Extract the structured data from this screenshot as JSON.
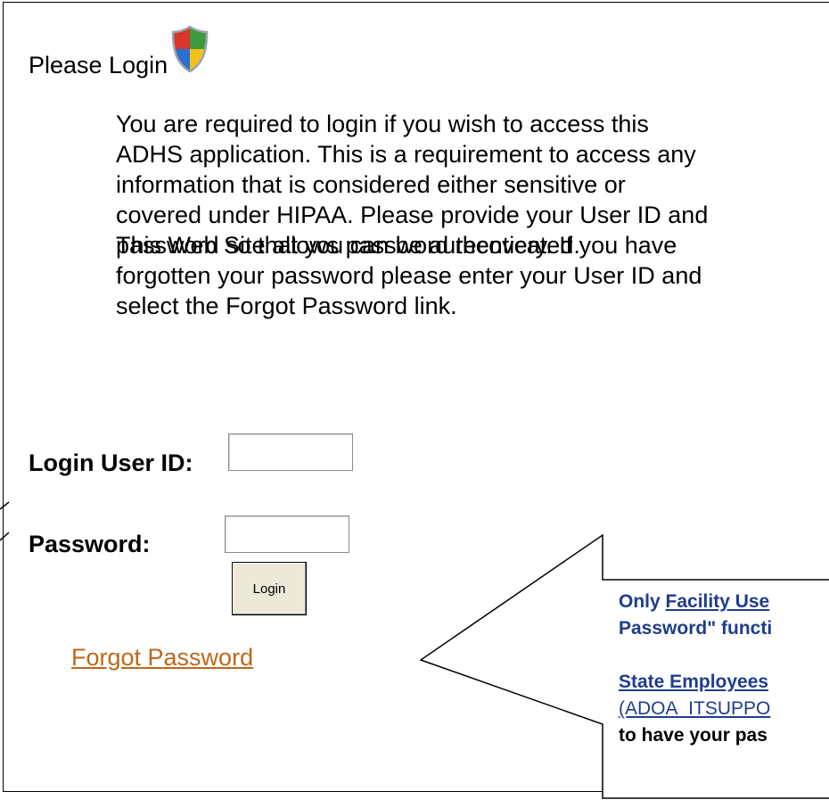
{
  "header": {
    "title": "Please Login",
    "icon": "shield-icon"
  },
  "intro": {
    "paragraph1": [
      "You are required to login if you wish to access this",
      "ADHS application.  This is a requirement to access any",
      "information that is considered either sensitive or",
      "covered under HIPAA.  Please provide your User ID and",
      "password so that you can be authenticated."
    ],
    "paragraph2": [
      "This Web Site allows password recovery.  If you have",
      "forgotten your password please enter your User ID and",
      "select the Forgot Password link."
    ]
  },
  "form": {
    "user_id_label": "Login User ID:",
    "user_id_value": "",
    "password_label": "Password:",
    "password_value": "",
    "login_button": "Login",
    "forgot_link": "Forgot Password"
  },
  "callout": {
    "line1_prefix": "Only ",
    "line1_link": "Facility Use",
    "line2": "Password\" functi",
    "line3_link": "State Employees",
    "line4_link": "(ADOA_ITSUPPO",
    "line5": " to have your pas",
    "text_color": "#1f3d8c"
  },
  "colors": {
    "link": "#c0661a",
    "button_face": "#ece9d8"
  }
}
